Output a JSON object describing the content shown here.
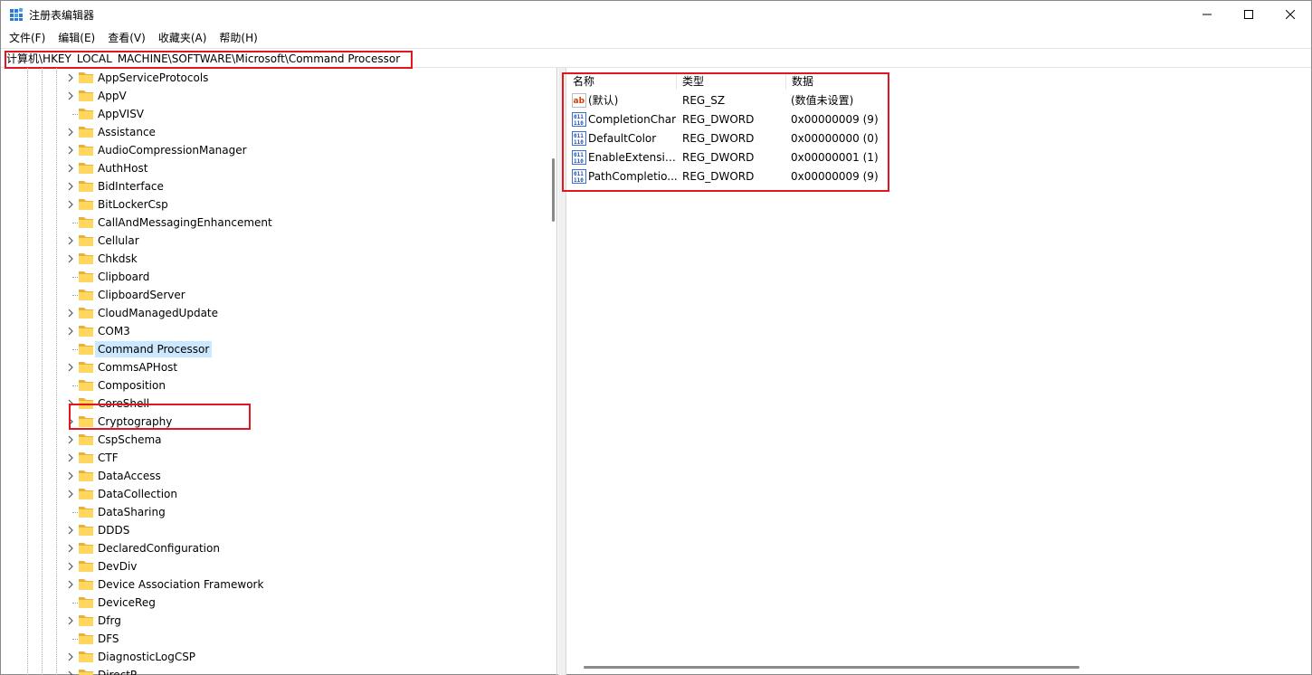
{
  "window": {
    "title": "注册表编辑器",
    "controls": {
      "minimize": "minimize",
      "maximize": "maximize",
      "close": "close"
    }
  },
  "menu": {
    "file": "文件(F)",
    "edit": "编辑(E)",
    "view": "查看(V)",
    "favorites": "收藏夹(A)",
    "help": "帮助(H)"
  },
  "address": {
    "path": "计算机\\HKEY_LOCAL_MACHINE\\SOFTWARE\\Microsoft\\Command Processor"
  },
  "tree": {
    "items": [
      {
        "label": "AppServiceProtocols",
        "expandable": true
      },
      {
        "label": "AppV",
        "expandable": true
      },
      {
        "label": "AppVISV",
        "expandable": false
      },
      {
        "label": "Assistance",
        "expandable": true
      },
      {
        "label": "AudioCompressionManager",
        "expandable": true
      },
      {
        "label": "AuthHost",
        "expandable": true
      },
      {
        "label": "BidInterface",
        "expandable": true
      },
      {
        "label": "BitLockerCsp",
        "expandable": true
      },
      {
        "label": "CallAndMessagingEnhancement",
        "expandable": false
      },
      {
        "label": "Cellular",
        "expandable": true
      },
      {
        "label": "Chkdsk",
        "expandable": true
      },
      {
        "label": "Clipboard",
        "expandable": false
      },
      {
        "label": "ClipboardServer",
        "expandable": false
      },
      {
        "label": "CloudManagedUpdate",
        "expandable": true
      },
      {
        "label": "COM3",
        "expandable": true
      },
      {
        "label": "Command Processor",
        "expandable": false,
        "selected": true
      },
      {
        "label": "CommsAPHost",
        "expandable": true
      },
      {
        "label": "Composition",
        "expandable": false
      },
      {
        "label": "CoreShell",
        "expandable": true
      },
      {
        "label": "Cryptography",
        "expandable": true
      },
      {
        "label": "CspSchema",
        "expandable": true
      },
      {
        "label": "CTF",
        "expandable": true
      },
      {
        "label": "DataAccess",
        "expandable": true
      },
      {
        "label": "DataCollection",
        "expandable": true
      },
      {
        "label": "DataSharing",
        "expandable": false
      },
      {
        "label": "DDDS",
        "expandable": true
      },
      {
        "label": "DeclaredConfiguration",
        "expandable": true
      },
      {
        "label": "DevDiv",
        "expandable": true
      },
      {
        "label": "Device Association Framework",
        "expandable": true
      },
      {
        "label": "DeviceReg",
        "expandable": false
      },
      {
        "label": "Dfrg",
        "expandable": true
      },
      {
        "label": "DFS",
        "expandable": false
      },
      {
        "label": "DiagnosticLogCSP",
        "expandable": true
      },
      {
        "label": "DirectP...",
        "expandable": true
      }
    ]
  },
  "values": {
    "headers": {
      "name": "名称",
      "type": "类型",
      "data": "数据"
    },
    "rows": [
      {
        "icon": "string-value-icon",
        "name": "(默认)",
        "type": "REG_SZ",
        "data": "(数值未设置)"
      },
      {
        "icon": "binary-value-icon",
        "name": "CompletionChar",
        "type": "REG_DWORD",
        "data": "0x00000009 (9)"
      },
      {
        "icon": "binary-value-icon",
        "name": "DefaultColor",
        "type": "REG_DWORD",
        "data": "0x00000000 (0)"
      },
      {
        "icon": "binary-value-icon",
        "name": "EnableExtensio...",
        "type": "REG_DWORD",
        "data": "0x00000001 (1)"
      },
      {
        "icon": "binary-value-icon",
        "name": "PathCompletio...",
        "type": "REG_DWORD",
        "data": "0x00000009 (9)"
      }
    ]
  },
  "colors": {
    "highlight_border": "#e0171f",
    "selection_bg": "#cce8ff",
    "folder_fill": "#ffd75e",
    "folder_dark": "#e8b23a"
  }
}
